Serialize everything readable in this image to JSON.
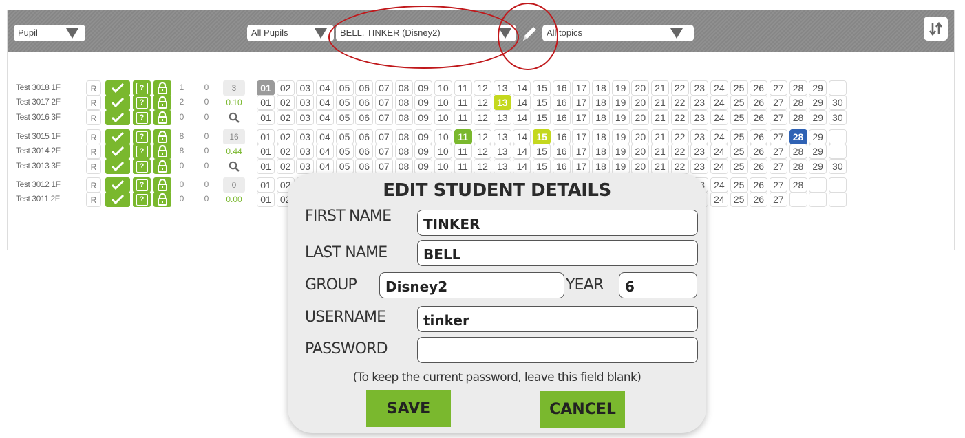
{
  "toolbar": {
    "view_select": "Pupil",
    "pupil_filter": "All Pupils",
    "pupil_select": "BELL, TINKER (Disney2)",
    "topic_select": "All topics"
  },
  "icons": {
    "edit": "pencil-icon",
    "sort": "sort-arrows-icon",
    "done": "check-icon",
    "help": "question-icon",
    "unlock": "unlock-icon",
    "search": "magnifier-icon",
    "dropdown": "triangle-down-icon"
  },
  "colors": {
    "toolbar": "#8a8a8a",
    "accent_green": "#7ab82e",
    "highlight_yellow": "#c4d81e",
    "highlight_blue": "#2f62b4",
    "highlight_grey": "#9a9a9a",
    "annotation_red": "#c0181b",
    "modal_bg": "#ececec"
  },
  "rows": [
    {
      "label": "Test 3018 1F",
      "r": "R",
      "a": "1",
      "b": "0",
      "score": "3",
      "days": 29,
      "hl": {
        "1": "grey"
      }
    },
    {
      "label": "Test 3017 2F",
      "r": "R",
      "a": "2",
      "b": "0",
      "score": "0.10",
      "days": 30,
      "hl": {
        "13": "yellow"
      }
    },
    {
      "label": "Test 3016 3F",
      "r": "R",
      "a": "0",
      "b": "0",
      "score": "search",
      "days": 30,
      "hl": {}
    },
    {
      "label": "Test 3015 1F",
      "r": "R",
      "a": "8",
      "b": "0",
      "score": "16",
      "days": 29,
      "hl": {
        "11": "green",
        "15": "yellow",
        "28": "blue"
      }
    },
    {
      "label": "Test 3014 2F",
      "r": "R",
      "a": "8",
      "b": "0",
      "score": "0.44",
      "days": 29,
      "hl": {}
    },
    {
      "label": "Test 3013 3F",
      "r": "R",
      "a": "0",
      "b": "0",
      "score": "search",
      "days": 30,
      "hl": {}
    },
    {
      "label": "Test 3012 1F",
      "r": "R",
      "a": "0",
      "b": "0",
      "score": "0",
      "days": 28,
      "hl": {}
    },
    {
      "label": "Test 3011 2F",
      "r": "R",
      "a": "0",
      "b": "0",
      "score": "0.00",
      "days": 27,
      "hl": {}
    }
  ],
  "modal": {
    "title": "EDIT STUDENT DETAILS",
    "first_name_label": "FIRST NAME",
    "first_name": "TINKER",
    "last_name_label": "LAST NAME",
    "last_name": "BELL",
    "group_label": "GROUP",
    "group": "Disney2",
    "year_label": "YEAR",
    "year": "6",
    "username_label": "USERNAME",
    "username": "tinker",
    "password_label": "PASSWORD",
    "password": "",
    "hint": "(To keep the current password, leave this field blank)",
    "save": "SAVE",
    "cancel": "CANCEL"
  }
}
